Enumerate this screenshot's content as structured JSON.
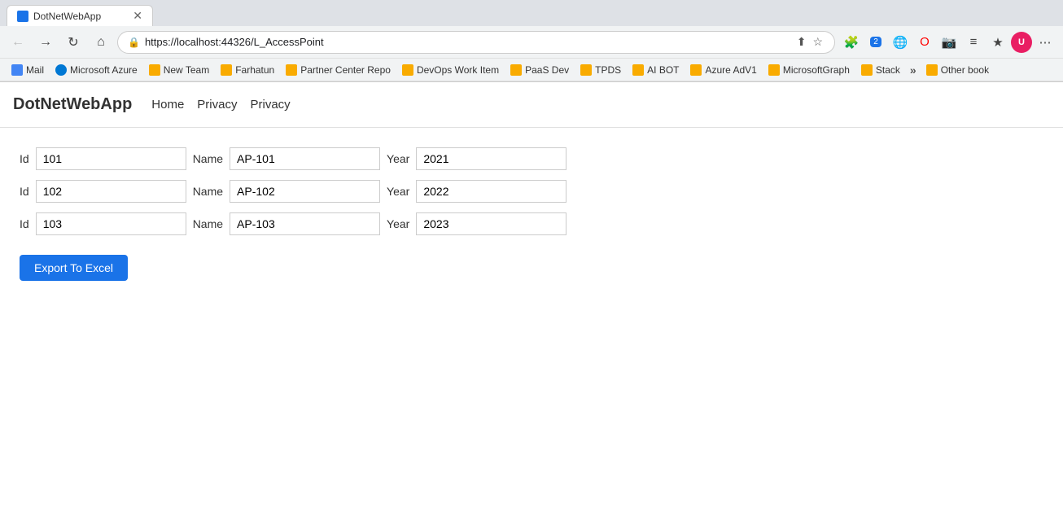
{
  "browser": {
    "tab": {
      "title": "DotNetWebApp",
      "favicon_color": "#1a73e8"
    },
    "address_bar": {
      "url": "https://localhost:44326/L_AccessPoint"
    },
    "bookmarks": [
      {
        "label": "Mail",
        "favicon_class": "bm-mail"
      },
      {
        "label": "Microsoft Azure",
        "favicon_class": "bm-azure"
      },
      {
        "label": "New Team",
        "favicon_class": "bm-folder"
      },
      {
        "label": "Farhatun",
        "favicon_class": "bm-folder"
      },
      {
        "label": "Partner Center Repo",
        "favicon_class": "bm-folder"
      },
      {
        "label": "DevOps Work Item",
        "favicon_class": "bm-folder"
      },
      {
        "label": "PaaS Dev",
        "favicon_class": "bm-folder"
      },
      {
        "label": "TPDS",
        "favicon_class": "bm-folder"
      },
      {
        "label": "AI BOT",
        "favicon_class": "bm-folder"
      },
      {
        "label": "Azure AdV1",
        "favicon_class": "bm-folder"
      },
      {
        "label": "MicrosoftGraph",
        "favicon_class": "bm-folder"
      },
      {
        "label": "Stack",
        "favicon_class": "bm-folder"
      },
      {
        "label": "Other book",
        "favicon_class": "bm-folder"
      }
    ]
  },
  "app": {
    "brand": "DotNetWebApp",
    "nav_links": [
      {
        "label": "Home"
      },
      {
        "label": "Privacy"
      },
      {
        "label": "Privacy"
      }
    ]
  },
  "records": [
    {
      "id": "101",
      "name": "AP-101",
      "year": "2021"
    },
    {
      "id": "102",
      "name": "AP-102",
      "year": "2022"
    },
    {
      "id": "103",
      "name": "AP-103",
      "year": "2023"
    }
  ],
  "labels": {
    "id": "Id",
    "name": "Name",
    "year": "Year",
    "export_button": "Export To Excel"
  }
}
